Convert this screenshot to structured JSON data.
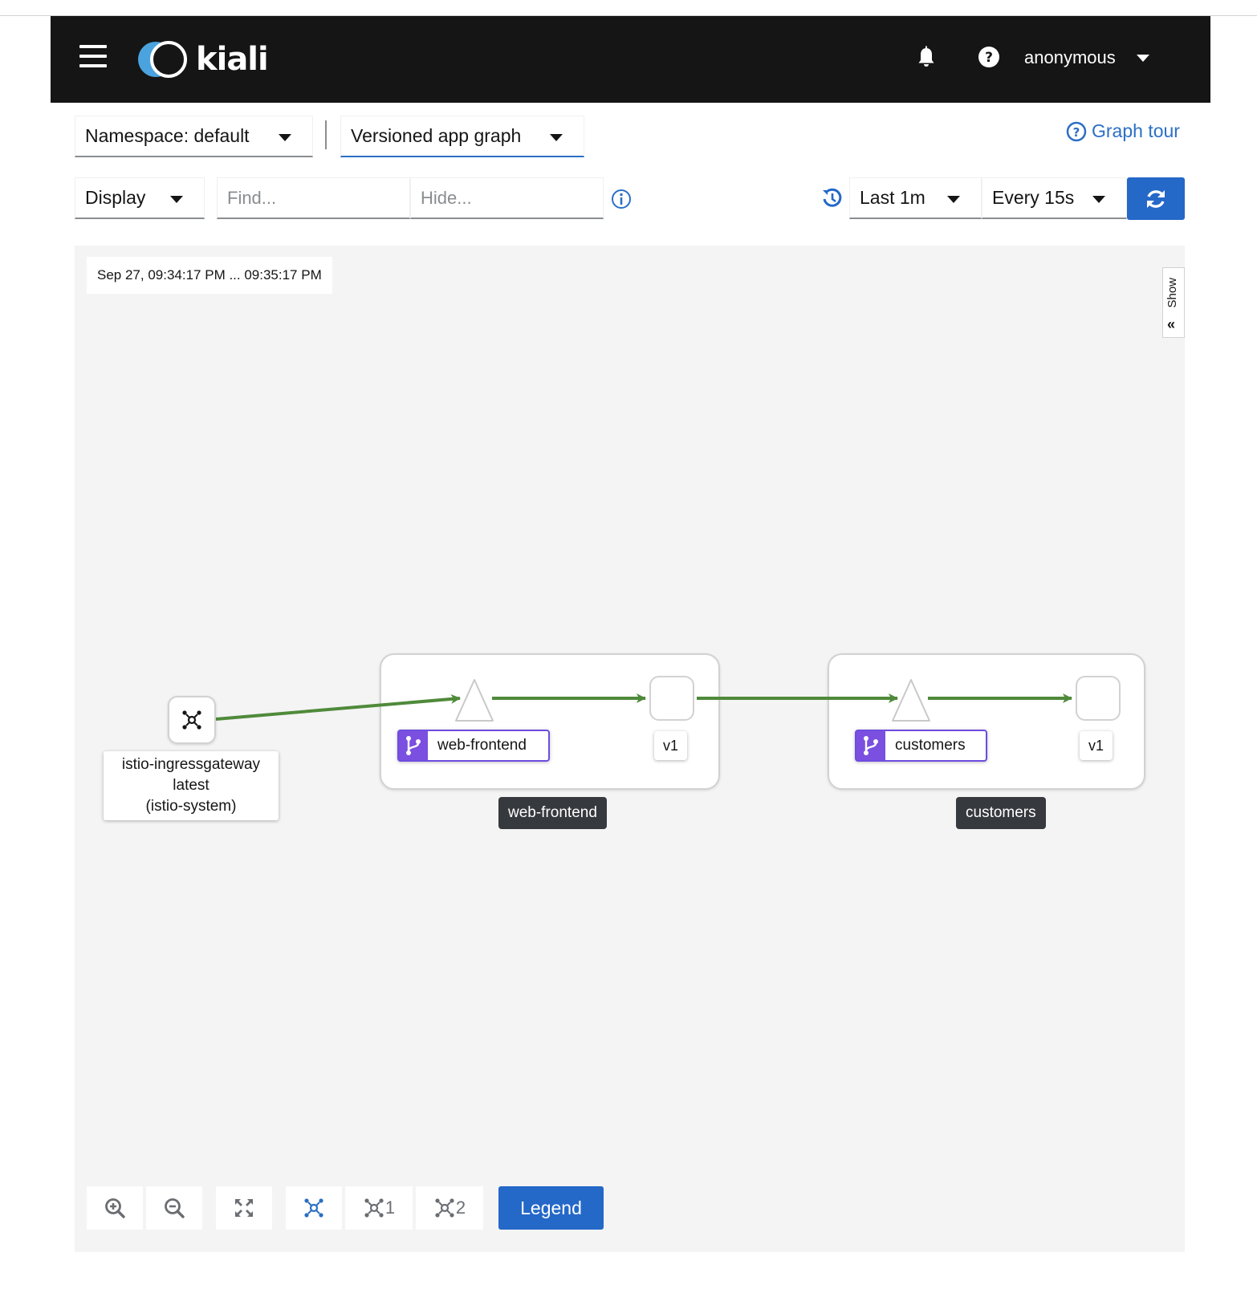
{
  "masthead": {
    "brand": "kiali",
    "user": "anonymous"
  },
  "toolbar1": {
    "namespace": "Namespace: default",
    "graph_type": "Versioned app graph",
    "graph_tour": "Graph tour"
  },
  "toolbar2": {
    "display": "Display",
    "find_placeholder": "Find...",
    "hide_placeholder": "Hide...",
    "duration": "Last 1m",
    "refresh_interval": "Every 15s"
  },
  "graph": {
    "timerange": "Sep 27, 09:34:17 PM ... 09:35:17 PM",
    "show_tab": "Show",
    "gateway": {
      "line1": "istio-ingressgateway",
      "line2": "latest",
      "line3": "(istio-system)"
    },
    "groups": [
      {
        "app": "web-frontend",
        "version": "v1",
        "box_label": "web-frontend"
      },
      {
        "app": "customers",
        "version": "v1",
        "box_label": "customers"
      }
    ],
    "edge_color": "#4f8a3a",
    "app_badge_color": "#7b4fe0"
  },
  "bottom_toolbar": {
    "layout1_label": "1",
    "layout2_label": "2",
    "legend": "Legend"
  },
  "colors": {
    "masthead_bg": "#151515",
    "primary": "#2468c8",
    "canvas_bg": "#f4f4f4"
  }
}
